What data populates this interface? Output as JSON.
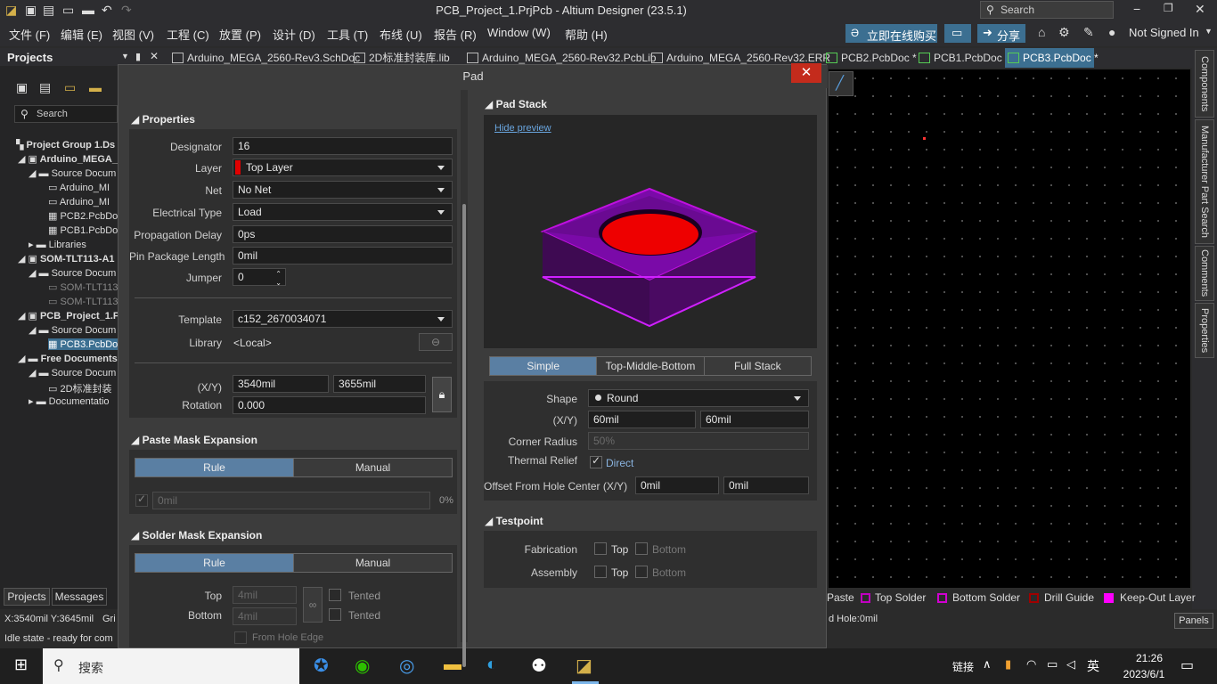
{
  "app": {
    "title": "PCB_Project_1.PrjPcb - Altium Designer (23.5.1)",
    "search_placeholder": "Search"
  },
  "menu": {
    "items": [
      "文件 (F)",
      "编辑 (E)",
      "视图 (V)",
      "工程 (C)",
      "放置 (P)",
      "设计 (D)",
      "工具 (T)",
      "布线 (U)",
      "报告 (R)",
      "Window (W)",
      "帮助 (H)"
    ],
    "buy_now": "立即在线购买",
    "share": "分享",
    "not_signed_in": "Not Signed In"
  },
  "tabs": [
    "Arduino_MEGA_2560-Rev3.SchDoc",
    "2D标准封装库.lib",
    "Arduino_MEGA_2560-Rev32.PcbLib",
    "Arduino_MEGA_2560-Rev32.ERR",
    "PCB2.PcbDoc *",
    "PCB1.PcbDoc *",
    "PCB3.PcbDoc *"
  ],
  "projects_panel": {
    "title": "Projects",
    "search": "Search",
    "tree": [
      "Project Group 1.Ds",
      "Arduino_MEGA_",
      "Source Docum",
      "Arduino_MI",
      "Arduino_MI",
      "PCB2.PcbDoc",
      "PCB1.PcbDoc",
      "Libraries",
      "SOM-TLT113-A1",
      "Source Docum",
      "SOM-TLT113",
      "SOM-TLT113",
      "PCB_Project_1.P",
      "Source Docum",
      "PCB3.PcbDoc",
      "Free Documents",
      "Source Docum",
      "2D标准封装",
      "Documentatio"
    ],
    "bottom_tabs": [
      "Projects",
      "Messages"
    ]
  },
  "dialog": {
    "title": "Pad",
    "close": "✕",
    "properties": {
      "header": "Properties",
      "designator_label": "Designator",
      "designator": "16",
      "layer_label": "Layer",
      "layer": "Top Layer",
      "net_label": "Net",
      "net": "No Net",
      "etype_label": "Electrical Type",
      "etype": "Load",
      "prop_delay_label": "Propagation Delay",
      "prop_delay": "0ps",
      "pin_len_label": "Pin Package Length",
      "pin_len": "0mil",
      "jumper_label": "Jumper",
      "jumper": "0",
      "template_label": "Template",
      "template": "c152_2670034071",
      "library_label": "Library",
      "library": "<Local>",
      "xy_label": "(X/Y)",
      "x": "3540mil",
      "y": "3655mil",
      "rotation_label": "Rotation",
      "rotation": "0.000"
    },
    "paste_mask": {
      "header": "Paste Mask Expansion",
      "rule": "Rule",
      "manual": "Manual",
      "value": "0mil",
      "percent": "0%"
    },
    "solder_mask": {
      "header": "Solder Mask Expansion",
      "rule": "Rule",
      "manual": "Manual",
      "top_label": "Top",
      "top": "4mil",
      "bottom_label": "Bottom",
      "bottom": "4mil",
      "tented": "Tented",
      "from_hole_edge": "From Hole Edge"
    },
    "pad_stack": {
      "header": "Pad Stack",
      "hide_preview": "Hide preview",
      "modes": [
        "Simple",
        "Top-Middle-Bottom",
        "Full Stack"
      ],
      "shape_label": "Shape",
      "shape": "Round",
      "xy_label": "(X/Y)",
      "x": "60mil",
      "y": "60mil",
      "corner_label": "Corner Radius",
      "corner": "50%",
      "thermal_label": "Thermal Relief",
      "thermal": "Direct",
      "offset_label": "Offset From Hole Center (X/Y)",
      "offset_x": "0mil",
      "offset_y": "0mil"
    },
    "testpoint": {
      "header": "Testpoint",
      "fab_label": "Fabrication",
      "asm_label": "Assembly",
      "top": "Top",
      "bottom": "Bottom"
    }
  },
  "right_panels": [
    "Components",
    "Manufacturer Part Search",
    "Comments",
    "Properties"
  ],
  "layers": [
    {
      "name": "Paste",
      "color": "#808080"
    },
    {
      "name": "Top Solder",
      "color": "#c000c0"
    },
    {
      "name": "Bottom Solder",
      "color": "#d000d0"
    },
    {
      "name": "Drill Guide",
      "color": "#a00000"
    },
    {
      "name": "Keep-Out Layer",
      "color": "#ff00ff"
    }
  ],
  "status": {
    "coords": "X:3540mil Y:3645mil",
    "grid": "Gri",
    "state": "Idle state - ready for com",
    "hole": "d Hole:0mil",
    "panels": "Panels"
  },
  "taskbar": {
    "search": "搜索",
    "link": "链接",
    "ime": "英",
    "time": "21:26",
    "date": "2023/6/1"
  }
}
